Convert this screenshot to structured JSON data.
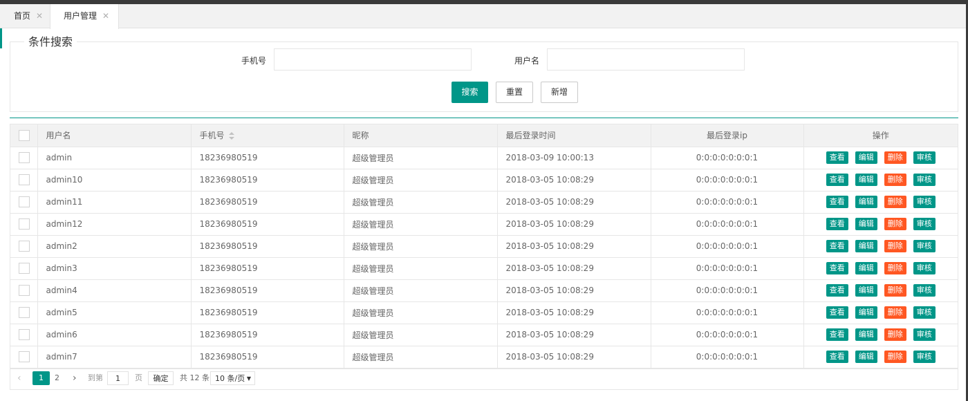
{
  "tabs": [
    {
      "label": "首页",
      "close": "✕"
    },
    {
      "label": "用户管理",
      "close": "✕"
    }
  ],
  "search": {
    "legend": "条件搜索",
    "phone_label": "手机号",
    "phone_value": "",
    "username_label": "用户名",
    "username_value": "",
    "search_button": "搜索",
    "reset_button": "重置",
    "add_button": "新增"
  },
  "table": {
    "columns": [
      "用户名",
      "手机号",
      "昵称",
      "最后登录时间",
      "最后登录ip",
      "操作"
    ],
    "actions": {
      "view": "查看",
      "edit": "编辑",
      "delete": "删除",
      "audit": "审核"
    },
    "rows": [
      {
        "username": "admin",
        "phone": "18236980519",
        "nickname": "超级管理员",
        "last_login": "2018-03-09 10:00:13",
        "ip": "0:0:0:0:0:0:0:1"
      },
      {
        "username": "admin10",
        "phone": "18236980519",
        "nickname": "超级管理员",
        "last_login": "2018-03-05 10:08:29",
        "ip": "0:0:0:0:0:0:0:1"
      },
      {
        "username": "admin11",
        "phone": "18236980519",
        "nickname": "超级管理员",
        "last_login": "2018-03-05 10:08:29",
        "ip": "0:0:0:0:0:0:0:1"
      },
      {
        "username": "admin12",
        "phone": "18236980519",
        "nickname": "超级管理员",
        "last_login": "2018-03-05 10:08:29",
        "ip": "0:0:0:0:0:0:0:1"
      },
      {
        "username": "admin2",
        "phone": "18236980519",
        "nickname": "超级管理员",
        "last_login": "2018-03-05 10:08:29",
        "ip": "0:0:0:0:0:0:0:1"
      },
      {
        "username": "admin3",
        "phone": "18236980519",
        "nickname": "超级管理员",
        "last_login": "2018-03-05 10:08:29",
        "ip": "0:0:0:0:0:0:0:1"
      },
      {
        "username": "admin4",
        "phone": "18236980519",
        "nickname": "超级管理员",
        "last_login": "2018-03-05 10:08:29",
        "ip": "0:0:0:0:0:0:0:1"
      },
      {
        "username": "admin5",
        "phone": "18236980519",
        "nickname": "超级管理员",
        "last_login": "2018-03-05 10:08:29",
        "ip": "0:0:0:0:0:0:0:1"
      },
      {
        "username": "admin6",
        "phone": "18236980519",
        "nickname": "超级管理员",
        "last_login": "2018-03-05 10:08:29",
        "ip": "0:0:0:0:0:0:0:1"
      },
      {
        "username": "admin7",
        "phone": "18236980519",
        "nickname": "超级管理员",
        "last_login": "2018-03-05 10:08:29",
        "ip": "0:0:0:0:0:0:0:1"
      }
    ]
  },
  "pagination": {
    "prev": "‹",
    "current": "1",
    "page2": "2",
    "next": "›",
    "goto_label": "到第",
    "goto_value": "1",
    "page_label": "页",
    "confirm": "确定",
    "total": "共 12 条",
    "page_size": "10 条/页",
    "size_caret": "▼"
  },
  "colors": {
    "primary": "#009688",
    "danger": "#ff5722"
  }
}
